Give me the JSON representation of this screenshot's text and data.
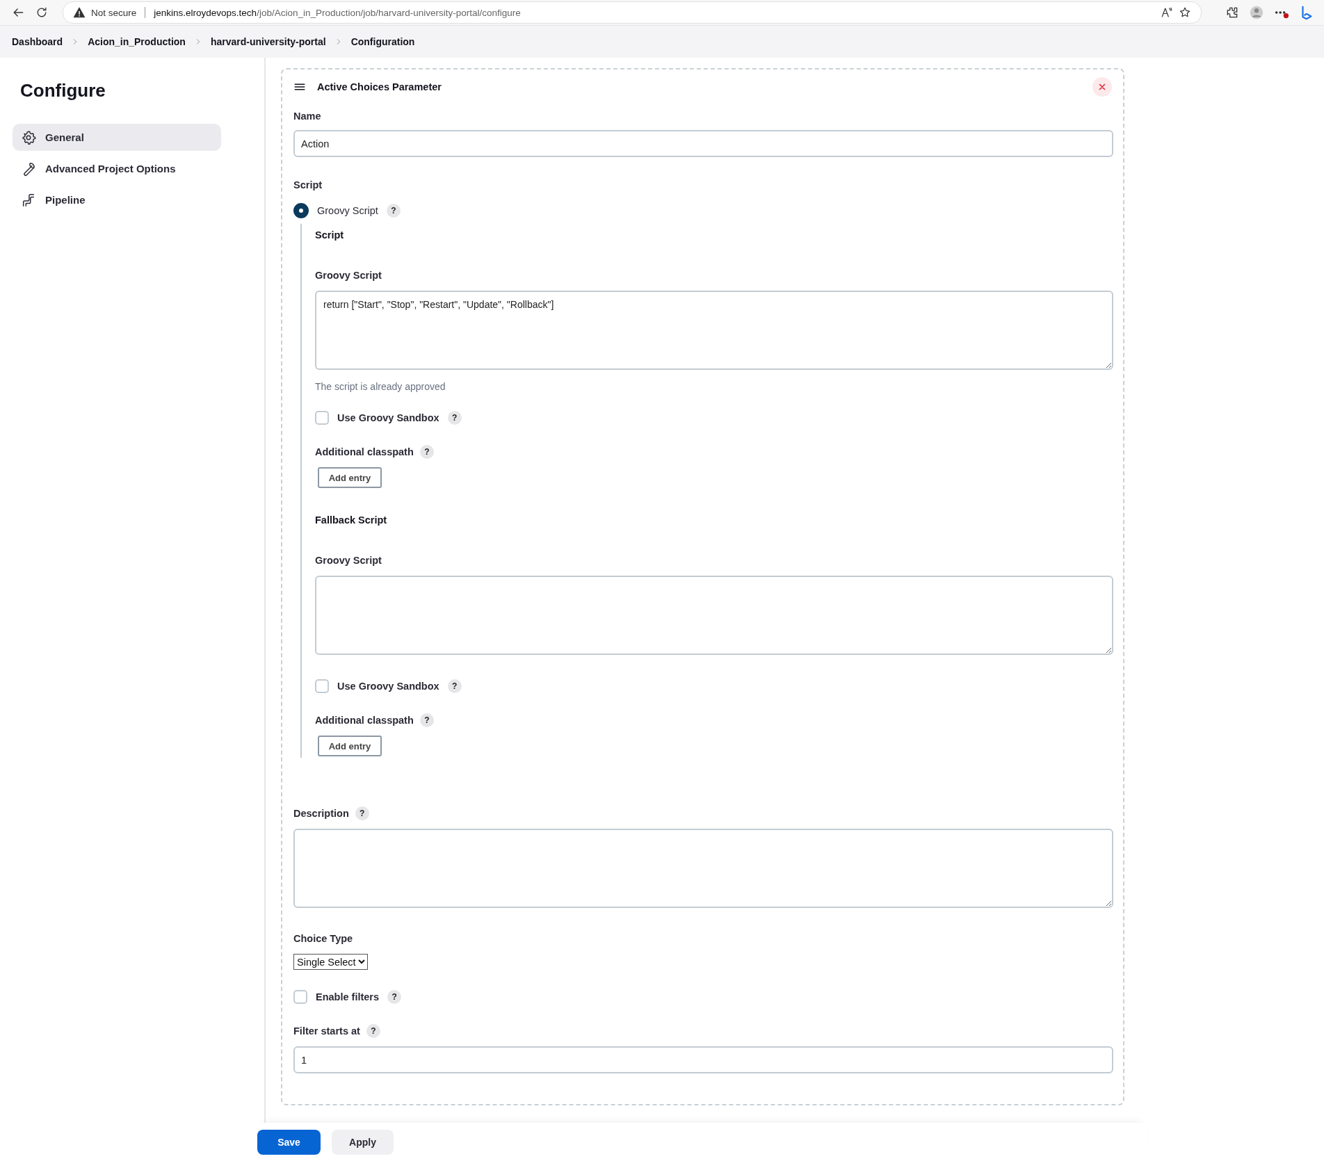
{
  "browser": {
    "security": "Not secure",
    "url_host": "jenkins.elroydevops.tech",
    "url_path": "/job/Acion_in_Production/job/harvard-university-portal/configure"
  },
  "breadcrumbs": [
    "Dashboard",
    "Acion_in_Production",
    "harvard-university-portal",
    "Configuration"
  ],
  "sidebar": {
    "title": "Configure",
    "items": [
      {
        "label": "General",
        "kind": "gear",
        "selected": true
      },
      {
        "label": "Advanced Project Options",
        "kind": "wrench",
        "selected": false
      },
      {
        "label": "Pipeline",
        "kind": "pipeline",
        "selected": false
      }
    ]
  },
  "parameter": {
    "title": "Active Choices Parameter",
    "name_label": "Name",
    "name_value": "Action",
    "script_label": "Script",
    "script_option": {
      "label": "Groovy Script",
      "help": "?",
      "selected": true
    },
    "scripts": [
      {
        "heading": "Script",
        "script_label": "Groovy Script",
        "code": "return [\"Start\", \"Stop\", \"Restart\", \"Update\", \"Rollback\"]",
        "note": "The script is already approved",
        "sandbox": {
          "label": "Use Groovy Sandbox",
          "help": "?",
          "checked": false
        },
        "classpath_label": "Additional classpath",
        "classpath_help": "?",
        "add_button": "Add entry"
      },
      {
        "heading": "Fallback Script",
        "script_label": "Groovy Script",
        "sandbox": {
          "label": "Use Groovy Sandbox",
          "help": "?",
          "checked": false
        },
        "classpath_label": "Additional classpath",
        "classpath_help": "?",
        "add_button": "Add entry"
      }
    ],
    "description_label": "Description",
    "description_help": "?",
    "choice_type_label": "Choice Type",
    "choice_type_value": "Single Select",
    "enable_filters": {
      "label": "Enable filters",
      "help": "?",
      "checked": false
    },
    "filter_start_label": "Filter starts at",
    "filter_start_help": "?",
    "filter_start_value": "1"
  },
  "buttons": [
    {
      "label": "Save",
      "kind": "primary"
    },
    {
      "label": "Apply",
      "kind": "secondary"
    }
  ]
}
